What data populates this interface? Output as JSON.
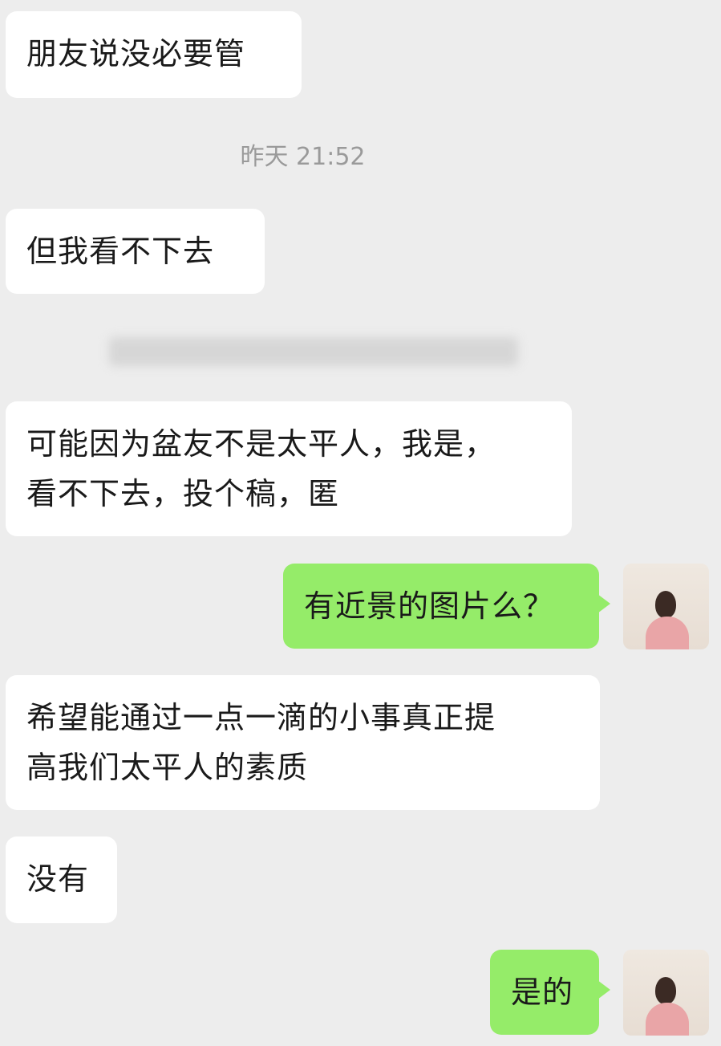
{
  "colors": {
    "background": "#ededed",
    "incoming_bubble": "#ffffff",
    "outgoing_bubble": "#95ec69",
    "timestamp": "#9a9a9a"
  },
  "chat": {
    "timestamp": "昨天 21:52",
    "messages": [
      {
        "side": "incoming",
        "text": "朋友说没必要管"
      },
      {
        "side": "incoming",
        "text": "但我看不下去"
      },
      {
        "side": "incoming",
        "text": "可能因为盆友不是太平人，我是，\n看不下去，投个稿，匿"
      },
      {
        "side": "outgoing",
        "text": "有近景的图片么？"
      },
      {
        "side": "incoming",
        "text": "希望能通过一点一滴的小事真正提\n高我们太平人的素质"
      },
      {
        "side": "incoming",
        "text": "没有"
      },
      {
        "side": "outgoing",
        "text": "是的"
      }
    ]
  },
  "avatar": {
    "icon": "user-avatar"
  }
}
